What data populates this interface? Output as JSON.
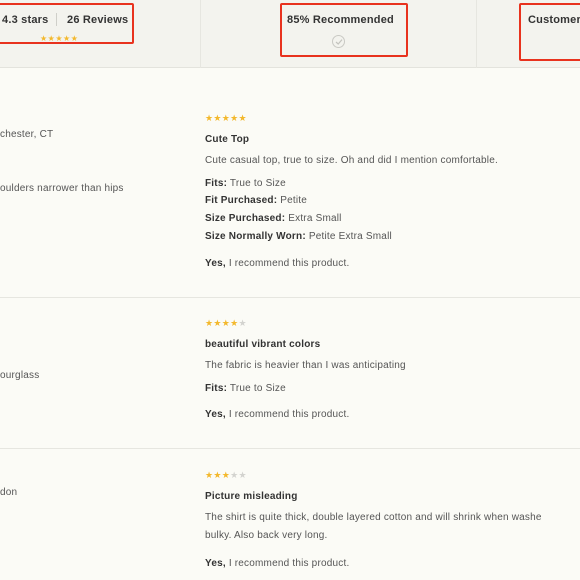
{
  "summary": {
    "rating": "4.3 stars",
    "reviews": "26 Reviews",
    "stars": "★★★★★",
    "recommended": "85% Recommended",
    "customers": "Customers"
  },
  "reviews": [
    {
      "location": "chester, CT",
      "body_type": "oulders narrower than hips",
      "rating": 5,
      "stars_on": "★★★★★",
      "stars_off": "",
      "title": "Cute Top",
      "text": "Cute casual top, true to size. Oh and did I mention comfortable.",
      "attributes": [
        {
          "label": "Fits:",
          "value": "True to Size"
        },
        {
          "label": "Fit Purchased:",
          "value": "Petite"
        },
        {
          "label": "Size Purchased:",
          "value": "Extra Small"
        },
        {
          "label": "Size Normally Worn:",
          "value": "Petite Extra Small"
        }
      ],
      "recommend_yes": "Yes,",
      "recommend_text": "I recommend this product."
    },
    {
      "body_type": "ourglass",
      "rating": 4,
      "stars_on": "★★★★",
      "stars_off": "★",
      "title": "beautiful vibrant colors",
      "text": "The fabric is heavier than I was anticipating",
      "attributes": [
        {
          "label": "Fits:",
          "value": "True to Size"
        }
      ],
      "recommend_yes": "Yes,",
      "recommend_text": "I recommend this product."
    },
    {
      "location": "don",
      "rating": 3,
      "stars_on": "★★★",
      "stars_off": "★★",
      "title": "Picture misleading",
      "text_line1": "The shirt is quite thick, double layered cotton and will shrink when washe",
      "text_line2": "bulky. Also back very long.",
      "recommend_yes": "Yes,",
      "recommend_text": "I recommend this product."
    }
  ],
  "colors": {
    "star": "#f3b82c",
    "highlight": "#e8321e",
    "background": "#fbfbf6"
  }
}
